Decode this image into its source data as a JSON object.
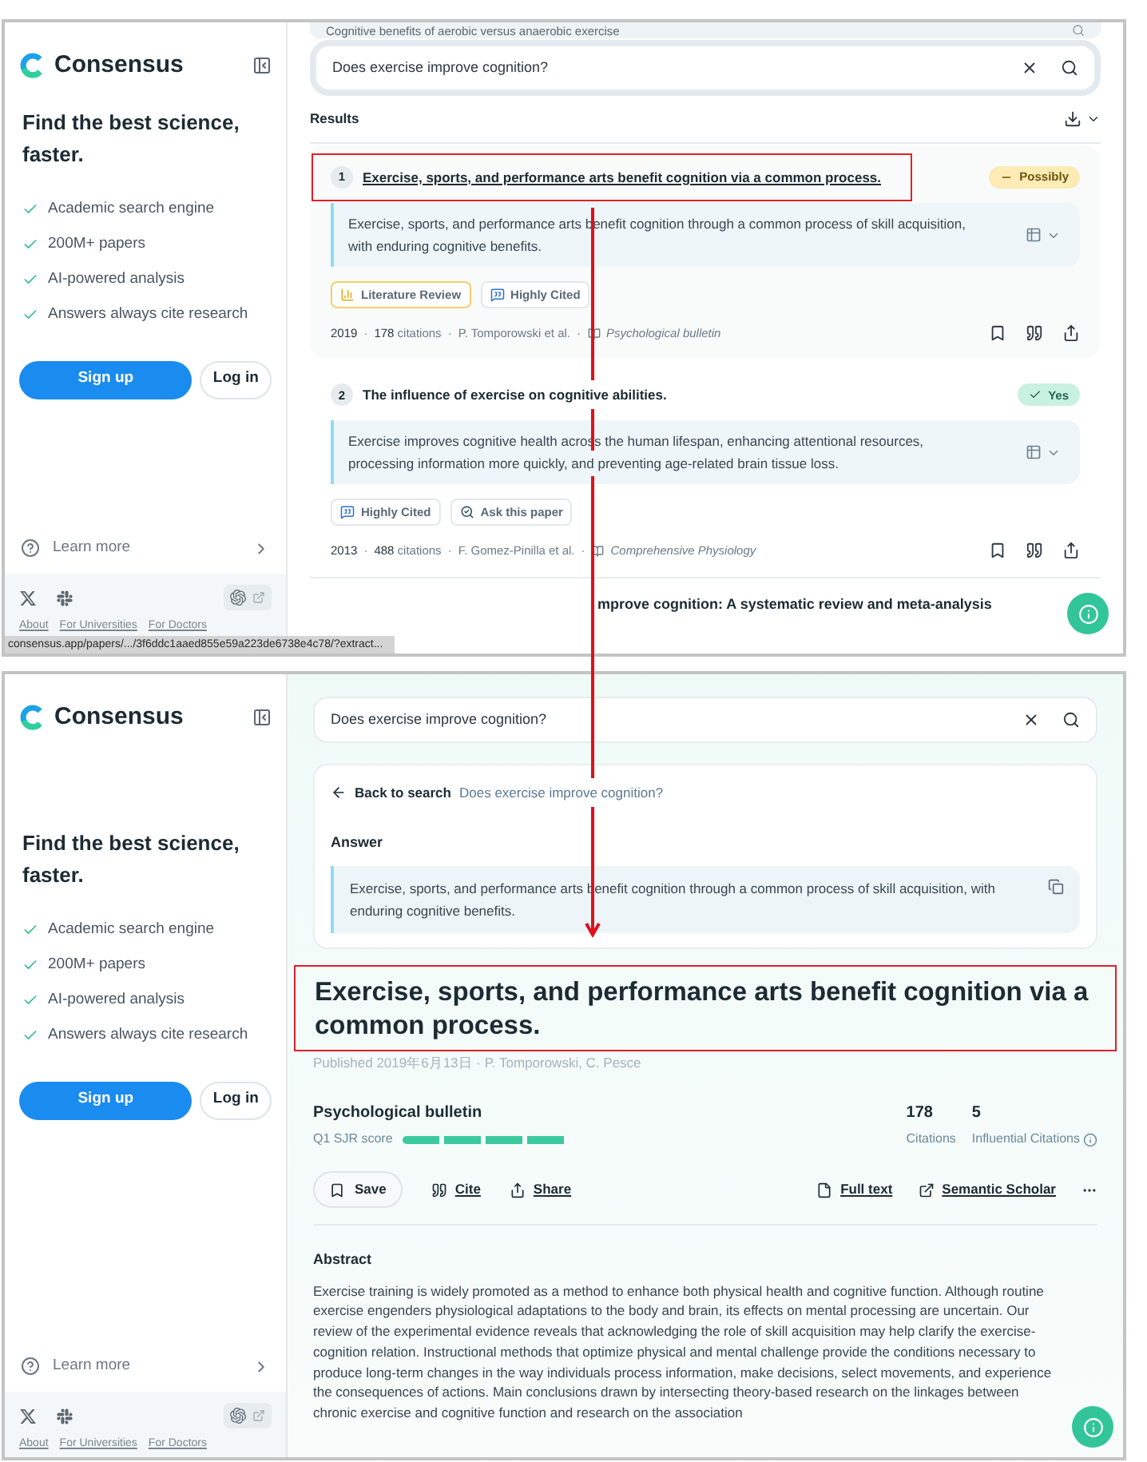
{
  "top_screen": {
    "sidebar": {
      "brand": "Consensus",
      "tagline": "Find the best science, faster.",
      "features": [
        "Academic search engine",
        "200M+ papers",
        "AI-powered analysis",
        "Answers always cite research"
      ],
      "signup": "Sign up",
      "login": "Log in",
      "learn_more": "Learn more",
      "footer_links": [
        "About",
        "For Universities",
        "For Doctors"
      ]
    },
    "suggestion": "Cognitive benefits of aerobic versus anaerobic exercise",
    "query": "Does exercise improve cognition?",
    "results_heading": "Results",
    "results": [
      {
        "number": "1",
        "title": "Exercise, sports, and performance arts benefit cognition via a common process.",
        "highlighted": true,
        "answer": {
          "label": "Possibly",
          "kind": "possibly"
        },
        "summary": "Exercise, sports, and performance arts benefit cognition through a common process of skill acquisition, with enduring cognitive benefits.",
        "tags": [
          {
            "label": "Literature Review",
            "kind": "review"
          },
          {
            "label": "Highly Cited",
            "kind": "cited"
          }
        ],
        "year": "2019",
        "citations": "178",
        "citations_label": "citations",
        "authors": "P. Tomporowski et al.",
        "journal": "Psychological bulletin",
        "separator": "·"
      },
      {
        "number": "2",
        "title": "The influence of exercise on cognitive abilities.",
        "highlighted": false,
        "answer": {
          "label": "Yes",
          "kind": "yes"
        },
        "summary": "Exercise improves cognitive health across the human lifespan, enhancing attentional resources, processing information more quickly, and preventing age-related brain tissue loss.",
        "tags": [
          {
            "label": "Highly Cited",
            "kind": "cited"
          },
          {
            "label": "Ask this paper",
            "kind": "ask"
          }
        ],
        "year": "2013",
        "citations": "488",
        "citations_label": "citations",
        "authors": "F. Gomez-Pinilla et al.",
        "journal": "Comprehensive Physiology",
        "separator": "·"
      }
    ],
    "partial_result_title": "mprove cognition: A systematic review and meta-analysis",
    "status_url": "consensus.app/papers/.../3f6ddc1aaed855e59a223de6738e4c78/?extract..."
  },
  "bottom_screen": {
    "sidebar": {
      "brand": "Consensus",
      "tagline": "Find the best science, faster.",
      "features": [
        "Academic search engine",
        "200M+ papers",
        "AI-powered analysis",
        "Answers always cite research"
      ],
      "signup": "Sign up",
      "login": "Log in",
      "learn_more": "Learn more",
      "footer_links": [
        "About",
        "For Universities",
        "For Doctors"
      ]
    },
    "query": "Does exercise improve cognition?",
    "back_label": "Back to search",
    "back_query": "Does exercise improve cognition?",
    "answer_heading": "Answer",
    "answer_text": "Exercise, sports, and performance arts benefit cognition through a common process of skill acquisition, with enduring cognitive benefits.",
    "paper": {
      "title": "Exercise, sports, and performance arts benefit cognition via a common process.",
      "highlighted": true,
      "published": "Published 2019年6月13日 · P. Tomporowski, C. Pesce",
      "journal": "Psychological bulletin",
      "sjr_label": "Q1 SJR score",
      "sjr": {
        "level": 1
      },
      "stats": [
        {
          "value": "178",
          "label": "Citations",
          "info": false
        },
        {
          "value": "5",
          "label": "Influential Citations",
          "info": true
        }
      ],
      "actions": [
        {
          "label": "Save",
          "kind": "save"
        },
        {
          "label": "Cite",
          "kind": "cite"
        },
        {
          "label": "Share",
          "kind": "share"
        }
      ],
      "links": [
        {
          "label": "Full text",
          "kind": "full_text"
        },
        {
          "label": "Semantic Scholar",
          "kind": "external"
        }
      ],
      "abstract_heading": "Abstract",
      "abstract": "Exercise training is widely promoted as a method to enhance both physical health and cognitive function. Although routine exercise engenders physiological adaptations to the body and brain, its effects on mental processing are uncertain. Our review of the experimental evidence reveals that acknowledging the role of skill acquisition may help clarify the exercise-cognition relation. Instructional methods that optimize physical and mental challenge provide the conditions necessary to produce long-term changes in the way individuals process information, make decisions, select movements, and experience the consequences of actions. Main conclusions drawn by intersecting theory-based research on the linkages between chronic exercise and cognitive function and research on the association"
    }
  }
}
